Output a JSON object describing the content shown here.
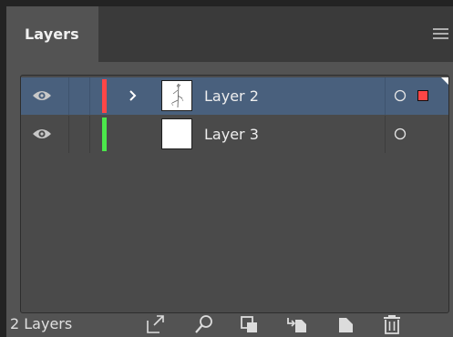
{
  "panel": {
    "tab_label": "Layers",
    "menu_icon": "hamburger-menu-icon"
  },
  "layers": [
    {
      "name": "Layer 2",
      "visible": true,
      "color": "#ff4646",
      "expandable": true,
      "selected": true,
      "has_selection_indicator": true,
      "thumbnail": "plant-sketch-thumbnail"
    },
    {
      "name": "Layer 3",
      "visible": true,
      "color": "#4be84b",
      "expandable": false,
      "selected": false,
      "has_selection_indicator": false,
      "thumbnail": "blank-thumbnail"
    }
  ],
  "footer": {
    "count_label": "2 Layers",
    "tools": [
      "export-icon",
      "locate-object-icon",
      "clipping-mask-icon",
      "create-sublayer-icon",
      "new-layer-icon",
      "trash-icon"
    ]
  },
  "colors": {
    "panel_bg": "#535353",
    "selected_row": "#49607d",
    "list_bg": "#4a4a4a"
  }
}
